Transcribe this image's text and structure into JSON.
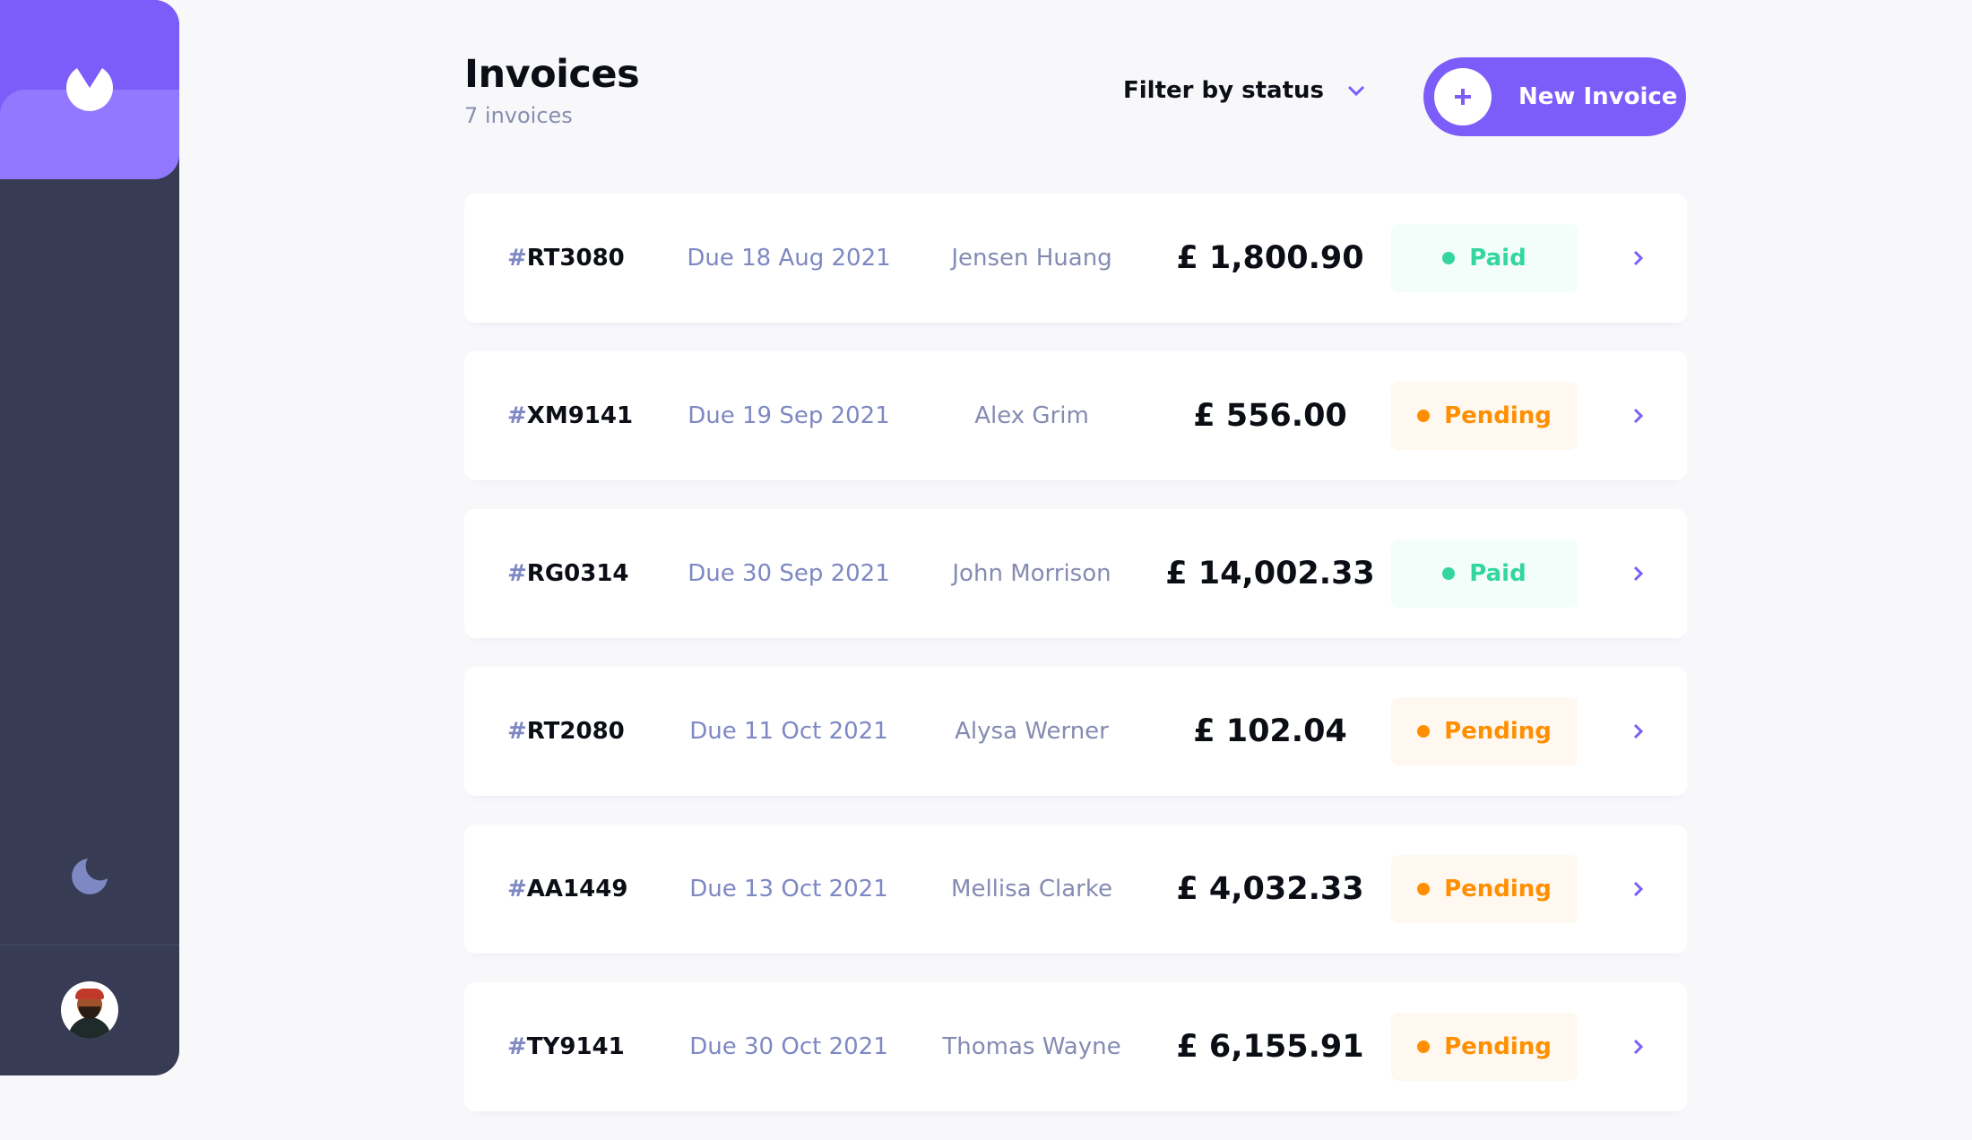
{
  "header": {
    "title": "Invoices",
    "count": "7 invoices",
    "filter_label": "Filter by status",
    "new_button_label": "New Invoice"
  },
  "sidebar": {
    "logo_icon": "logo-icon",
    "theme_icon": "moon-icon",
    "avatar_icon": "avatar"
  },
  "colors": {
    "accent": "#7c5dfa",
    "sidebar": "#373b53",
    "paid": "#33d69f",
    "pending": "#ff8f00"
  },
  "invoices": [
    {
      "hash": "#",
      "code": "RT3080",
      "due": "Due 18 Aug 2021",
      "client": "Jensen Huang",
      "amount": "£ 1,800.90",
      "status": "Paid",
      "status_kind": "paid"
    },
    {
      "hash": "#",
      "code": "XM9141",
      "due": "Due 19 Sep 2021",
      "client": "Alex Grim",
      "amount": "£ 556.00",
      "status": "Pending",
      "status_kind": "pending"
    },
    {
      "hash": "#",
      "code": "RG0314",
      "due": "Due 30 Sep 2021",
      "client": "John Morrison",
      "amount": "£ 14,002.33",
      "status": "Paid",
      "status_kind": "paid"
    },
    {
      "hash": "#",
      "code": "RT2080",
      "due": "Due 11 Oct 2021",
      "client": "Alysa Werner",
      "amount": "£ 102.04",
      "status": "Pending",
      "status_kind": "pending"
    },
    {
      "hash": "#",
      "code": "AA1449",
      "due": "Due 13 Oct 2021",
      "client": "Mellisa Clarke",
      "amount": "£ 4,032.33",
      "status": "Pending",
      "status_kind": "pending"
    },
    {
      "hash": "#",
      "code": "TY9141",
      "due": "Due 30 Oct 2021",
      "client": "Thomas Wayne",
      "amount": "£ 6,155.91",
      "status": "Pending",
      "status_kind": "pending"
    }
  ]
}
